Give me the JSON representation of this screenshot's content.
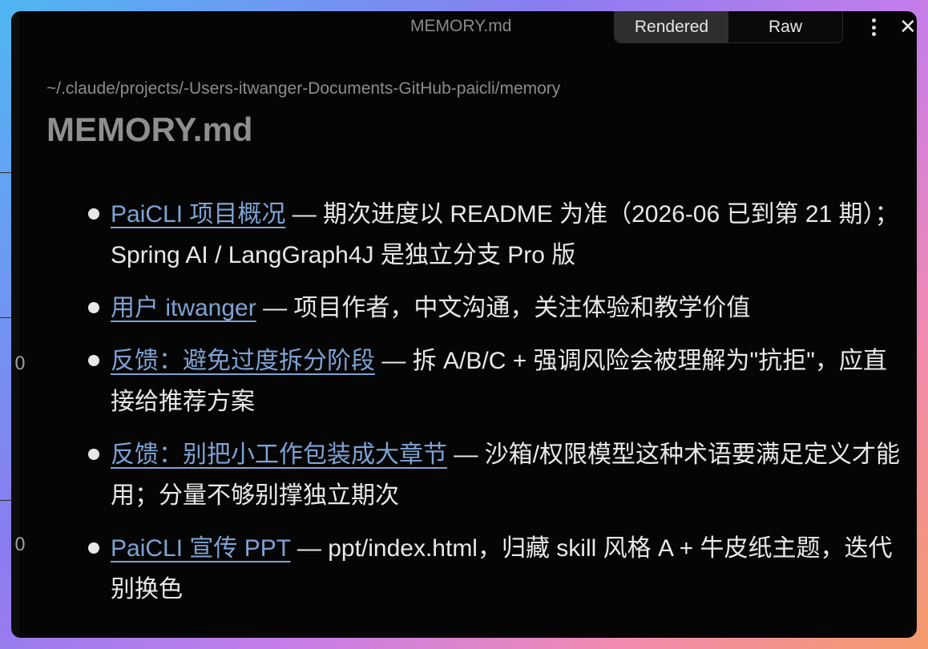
{
  "window": {
    "title": "MEMORY.md",
    "view_toggle": {
      "rendered_label": "Rendered",
      "raw_label": "Raw",
      "selected": "Rendered"
    }
  },
  "document": {
    "path": "~/.claude/projects/-Users-itwanger-Documents-GitHub-paicli/memory",
    "heading": "MEMORY.md",
    "entries": [
      {
        "link": "PaiCLI 项目概况",
        "text": " — 期次进度以 README 为准（2026-06 已到第 21 期）；Spring AI / LangGraph4J 是独立分支 Pro 版"
      },
      {
        "link": "用户 itwanger",
        "text": " — 项目作者，中文沟通，关注体验和教学价值"
      },
      {
        "link": "反馈：避免过度拆分阶段",
        "text": " — 拆 A/B/C + 强调风险会被理解为\"抗拒\"，应直接给推荐方案"
      },
      {
        "link": "反馈：别把小工作包装成大章节",
        "text": " — 沙箱/权限模型这种术语要满足定义才能用；分量不够别撑独立期次"
      },
      {
        "link": "PaiCLI 宣传 PPT",
        "text": " — ppt/index.html，归藏 skill 风格 A + 牛皮纸主题，迭代别换色"
      }
    ]
  },
  "background_fragments": [
    "0",
    "0"
  ],
  "colors": {
    "link": "#7ea3d4",
    "text": "#e8e8e8",
    "background": "#050505",
    "muted": "#8c8c8c"
  }
}
